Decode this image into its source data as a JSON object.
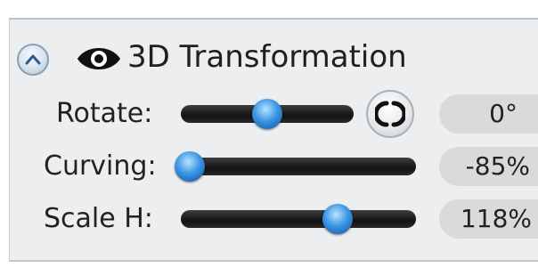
{
  "panel": {
    "title": "3D Transformation",
    "icons": {
      "collapse": "chevron-up-icon",
      "visibility": "eye-icon",
      "reset": "rotate-reset-icon"
    }
  },
  "controls": [
    {
      "id": "rotate",
      "label": "Rotate:",
      "value_text": "0°",
      "level": 0.5
    },
    {
      "id": "curving",
      "label": "Curving:",
      "value_text": "-85%",
      "level": 0.0
    },
    {
      "id": "scale_h",
      "label": "Scale H:",
      "value_text": "118%",
      "level": 0.68
    }
  ],
  "colors": {
    "panel_bg": "#eceeef",
    "track": "#1a1a1a",
    "thumb": "#3c97e5",
    "value_box": "#d8dadc"
  }
}
